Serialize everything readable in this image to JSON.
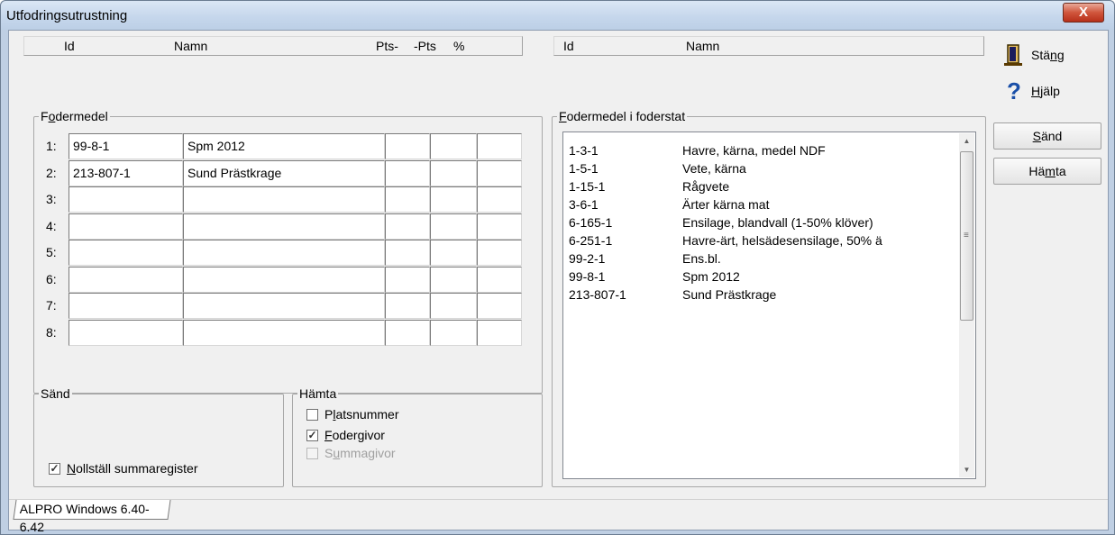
{
  "window": {
    "title": "Utfodringsutrustning",
    "close_label": "X"
  },
  "left_header": {
    "id": "Id",
    "name": "Namn",
    "pts_minus": "Pts-",
    "minus_pts": "-Pts",
    "percent": "%"
  },
  "right_header": {
    "id": "Id",
    "name": "Namn"
  },
  "fodermedel": {
    "legend": "Fodermedel",
    "rows": [
      {
        "label": "1:",
        "id": "99-8-1",
        "name": "Spm 2012"
      },
      {
        "label": "2:",
        "id": "213-807-1",
        "name": "Sund Prästkrage"
      },
      {
        "label": "3:",
        "id": "",
        "name": ""
      },
      {
        "label": "4:",
        "id": "",
        "name": ""
      },
      {
        "label": "5:",
        "id": "",
        "name": ""
      },
      {
        "label": "6:",
        "id": "",
        "name": ""
      },
      {
        "label": "7:",
        "id": "",
        "name": ""
      },
      {
        "label": "8:",
        "id": "",
        "name": ""
      }
    ]
  },
  "fodermedel_i_foderstat": {
    "legend": "Fodermedel i foderstat",
    "items": [
      {
        "id": "1-3-1",
        "name": "Havre, kärna, medel NDF"
      },
      {
        "id": "1-5-1",
        "name": "Vete, kärna"
      },
      {
        "id": "1-15-1",
        "name": "Rågvete"
      },
      {
        "id": "3-6-1",
        "name": "Ärter kärna mat"
      },
      {
        "id": "6-165-1",
        "name": "Ensilage, blandvall (1-50% klöver)"
      },
      {
        "id": "6-251-1",
        "name": "Havre-ärt, helsädesensilage, 50% ä"
      },
      {
        "id": "99-2-1",
        "name": "Ens.bl."
      },
      {
        "id": "99-8-1",
        "name": "Spm 2012"
      },
      {
        "id": "213-807-1",
        "name": "Sund Prästkrage"
      }
    ]
  },
  "sand_group": {
    "legend": "Sänd",
    "nollstall_label": "Nollställ summaregister",
    "nollstall_checked": true
  },
  "hamta_group": {
    "legend": "Hämta",
    "platsnummer_label": "Platsnummer",
    "platsnummer_checked": false,
    "fodergivor_label": "Fodergivor",
    "fodergivor_checked": true,
    "summagivor_label": "Summagivor",
    "summagivor_checked": false
  },
  "buttons": {
    "stang": "Stäng",
    "hjalp": "Hjälp",
    "sand": "Sänd",
    "hamta": "Hämta"
  },
  "tab": {
    "label": "ALPRO Windows 6.40-6.42"
  },
  "colors": {
    "titlebar": "#c6d7ec",
    "close_button": "#d0553c",
    "dialog_bg": "#f0f0f0"
  }
}
